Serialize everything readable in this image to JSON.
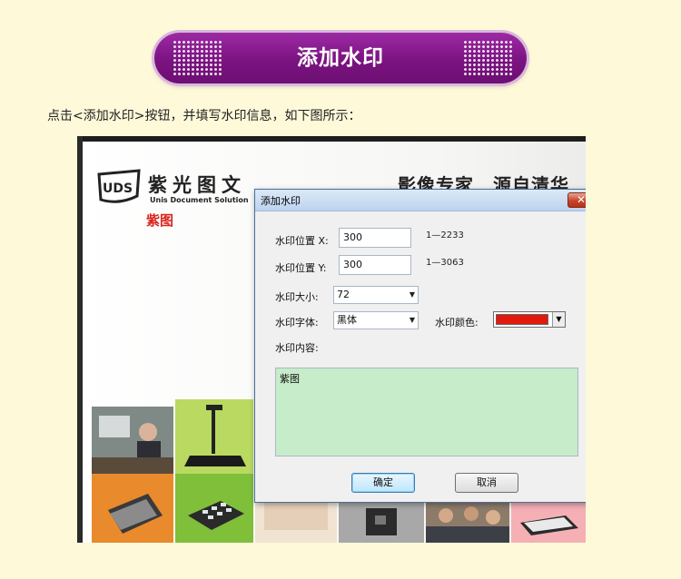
{
  "banner": {
    "title": "添加水印"
  },
  "instruction": "点击<添加水印>按钮，并填写水印信息，如下图所示：",
  "brochure": {
    "logo_text": "UDS",
    "brand_cn": "紫光图文",
    "brand_en": "Unis Document Solution",
    "brand_sub": "紫图",
    "slogan": "影像专家　源自清华"
  },
  "dialog": {
    "title": "添加水印",
    "close_label": "✕",
    "pos_x_label": "水印位置 X:",
    "pos_x_value": "300",
    "pos_x_range": "1—2233",
    "pos_y_label": "水印位置 Y:",
    "pos_y_value": "300",
    "pos_y_range": "1—3063",
    "size_label": "水印大小:",
    "size_value": "72",
    "font_label": "水印字体:",
    "font_value": "黑体",
    "color_label": "水印颜色:",
    "color_value": "#e2190d",
    "content_label": "水印内容:",
    "content_value": "紫图",
    "ok_label": "确定",
    "cancel_label": "取消"
  },
  "colors": {
    "page_bg": "#fdf9d9",
    "banner_purple": "#7b1381",
    "dialog_bg": "#f0f0f0",
    "content_bg": "#c6ecc9",
    "accent_red": "#d9251d"
  }
}
